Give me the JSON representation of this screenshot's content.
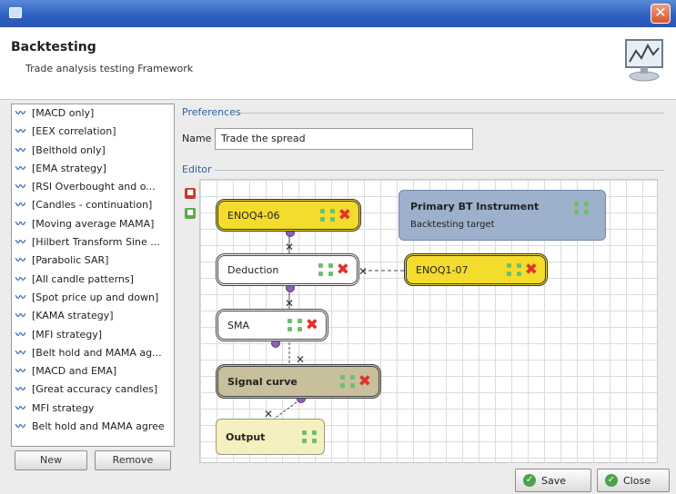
{
  "window": {
    "title_icon": "app-icon",
    "close_icon": "close-icon"
  },
  "header": {
    "title": "Backtesting",
    "subtitle": "Trade analysis testing Framework",
    "icon": "chart-monitor-icon"
  },
  "sidebar": {
    "items": [
      {
        "label": "[MACD only]"
      },
      {
        "label": "[EEX correlation]"
      },
      {
        "label": "[Belthold only]"
      },
      {
        "label": "[EMA strategy]"
      },
      {
        "label": "[RSI Overbought and o..."
      },
      {
        "label": "[Candles - continuation]"
      },
      {
        "label": "[Moving average MAMA]"
      },
      {
        "label": "[Hilbert Transform Sine ..."
      },
      {
        "label": "[Parabolic SAR]"
      },
      {
        "label": "[All candle patterns]"
      },
      {
        "label": "[Spot price up and down]"
      },
      {
        "label": "[KAMA strategy]"
      },
      {
        "label": "[MFI strategy]"
      },
      {
        "label": "[Belt hold and MAMA ag..."
      },
      {
        "label": "[MACD and EMA]"
      },
      {
        "label": "[Great accuracy candles]"
      },
      {
        "label": "MFI strategy"
      },
      {
        "label": "Belt hold and MAMA agree"
      }
    ],
    "new_button": "New",
    "remove_button": "Remove"
  },
  "preferences": {
    "group_label": "Preferences",
    "name_label": "Name",
    "name_value": "Trade the spread"
  },
  "editor": {
    "group_label": "Editor",
    "nodes": {
      "enoq4": "ENOQ4-06",
      "primary_title": "Primary BT Instrument",
      "primary_sub": "Backtesting target",
      "deduction": "Deduction",
      "enoq1": "ENOQ1-07",
      "sma": "SMA",
      "signal_curve": "Signal curve",
      "output": "Output"
    }
  },
  "footer": {
    "save_button": "Save",
    "close_button": "Close"
  },
  "colors": {
    "titlebar": "#2f5fc0",
    "node_yellow": "#f3dc2c",
    "node_tan": "#c8bf9c",
    "node_blue": "#9db0cc",
    "group_label": "#2f5f9f"
  }
}
